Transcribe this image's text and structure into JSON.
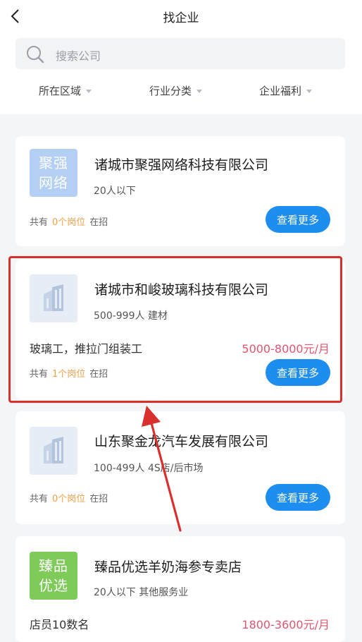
{
  "header": {
    "title": "找企业",
    "back_icon": "chevron-left-icon"
  },
  "search": {
    "placeholder": "搜索公司"
  },
  "filters": [
    {
      "label": "所在区域"
    },
    {
      "label": "行业分类"
    },
    {
      "label": "企业福利"
    }
  ],
  "companies": [
    {
      "logo_lines": [
        "聚强",
        "网络"
      ],
      "logo_color": "#b3cff4",
      "name": "诸城市聚强网络科技有限公司",
      "meta": "20人以下",
      "job": "",
      "salary": "",
      "openings_prefix": "共有",
      "openings_count": "0个岗位",
      "openings_suffix": "在招",
      "more_label": "查看更多"
    },
    {
      "logo_lines": [],
      "logo_color": "#e7edf6",
      "name": "诸城市和峻玻璃科技有限公司",
      "meta": "500-999人  建材",
      "job": "玻璃工，推拉门组装工",
      "salary": "5000-8000元/月",
      "openings_prefix": "共有",
      "openings_count": "1个岗位",
      "openings_suffix": "在招",
      "more_label": "查看更多"
    },
    {
      "logo_lines": [],
      "logo_color": "#e7edf6",
      "name": "山东聚金龙汽车发展有限公司",
      "meta": "100-499人  4S店/后市场",
      "job": "",
      "salary": "",
      "openings_prefix": "共有",
      "openings_count": "0个岗位",
      "openings_suffix": "在招",
      "more_label": "查看更多"
    },
    {
      "logo_lines": [
        "臻品",
        "优选"
      ],
      "logo_color": "#7ecb5a",
      "name": "臻品优选羊奶海参专卖店",
      "meta": "20人以下  其他服务业",
      "job": "店员10数名",
      "salary": "1800-3600元/月",
      "openings_prefix": "",
      "openings_count": "",
      "openings_suffix": "",
      "more_label": ""
    }
  ],
  "colors": {
    "accent": "#1d8ef0",
    "salary": "#e2556f",
    "count": "#f0a04b",
    "highlight": "#d9302e"
  }
}
